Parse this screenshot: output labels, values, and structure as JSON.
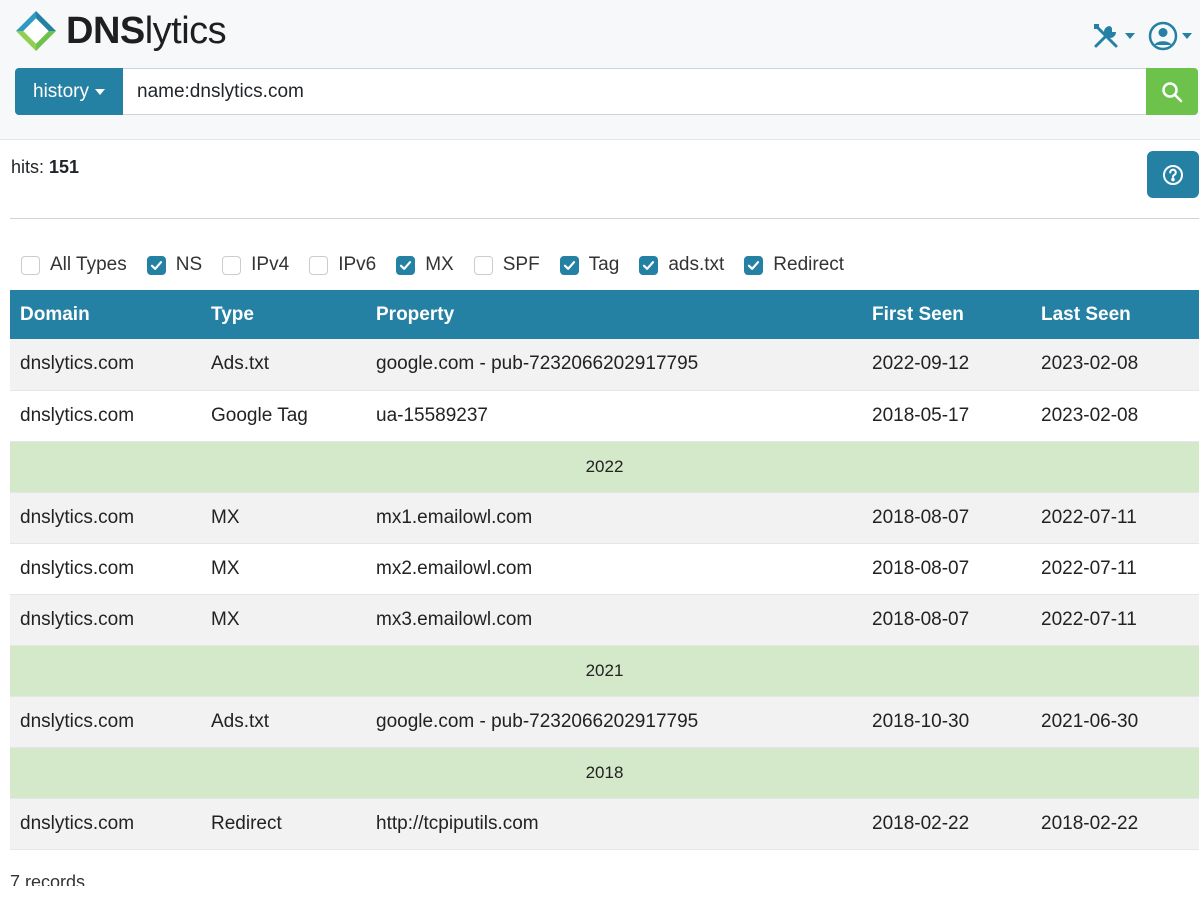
{
  "brand": {
    "name_bold": "DNS",
    "name_rest": "lytics"
  },
  "search": {
    "mode_label": "history",
    "query": "name:dnslytics.com"
  },
  "hits": {
    "label": "hits:",
    "count": "151"
  },
  "filters": [
    {
      "label": "All Types",
      "checked": false
    },
    {
      "label": "NS",
      "checked": true
    },
    {
      "label": "IPv4",
      "checked": false
    },
    {
      "label": "IPv6",
      "checked": false
    },
    {
      "label": "MX",
      "checked": true
    },
    {
      "label": "SPF",
      "checked": false
    },
    {
      "label": "Tag",
      "checked": true
    },
    {
      "label": "ads.txt",
      "checked": true
    },
    {
      "label": "Redirect",
      "checked": true
    }
  ],
  "table": {
    "headers": [
      "Domain",
      "Type",
      "Property",
      "First Seen",
      "Last Seen"
    ],
    "rows": [
      {
        "kind": "data",
        "domain": "dnslytics.com",
        "type": "Ads.txt",
        "property": "google.com - pub-7232066202917795",
        "first": "2022-09-12",
        "last": "2023-02-08"
      },
      {
        "kind": "data",
        "domain": "dnslytics.com",
        "type": "Google Tag",
        "property": "ua-15589237",
        "first": "2018-05-17",
        "last": "2023-02-08"
      },
      {
        "kind": "year",
        "label": "2022"
      },
      {
        "kind": "data",
        "domain": "dnslytics.com",
        "type": "MX",
        "property": "mx1.emailowl.com",
        "first": "2018-08-07",
        "last": "2022-07-11"
      },
      {
        "kind": "data",
        "domain": "dnslytics.com",
        "type": "MX",
        "property": "mx2.emailowl.com",
        "first": "2018-08-07",
        "last": "2022-07-11"
      },
      {
        "kind": "data",
        "domain": "dnslytics.com",
        "type": "MX",
        "property": "mx3.emailowl.com",
        "first": "2018-08-07",
        "last": "2022-07-11"
      },
      {
        "kind": "year",
        "label": "2021"
      },
      {
        "kind": "data",
        "domain": "dnslytics.com",
        "type": "Ads.txt",
        "property": "google.com - pub-7232066202917795",
        "first": "2018-10-30",
        "last": "2021-06-30"
      },
      {
        "kind": "year",
        "label": "2018"
      },
      {
        "kind": "data",
        "domain": "dnslytics.com",
        "type": "Redirect",
        "property": "http://tcpiputils.com",
        "first": "2018-02-22",
        "last": "2018-02-22"
      }
    ]
  },
  "footer": {
    "records": "7 records"
  },
  "colors": {
    "primary": "#2581a4",
    "search": "#6cc24a",
    "year_row": "#d4e8ca"
  },
  "icons": [
    "logo-icon",
    "tools-icon",
    "user-icon",
    "search-icon",
    "help-icon",
    "checkmark-icon"
  ]
}
